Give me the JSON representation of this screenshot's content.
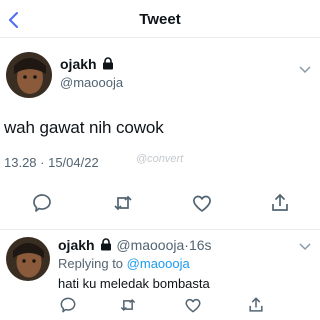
{
  "header": {
    "title": "Tweet"
  },
  "main_tweet": {
    "author_name": "ojakh",
    "author_handle": "@maoooja",
    "text": "wah gawat nih cowok",
    "timestamp": "13.28 · 15/04/22",
    "watermark": "@convert"
  },
  "reply": {
    "author_name": "ojakh",
    "author_handle": "@maoooja",
    "separator": "·",
    "time": "16s",
    "replying_prefix": "Replying to",
    "replying_to": "@maoooja",
    "text": "hati ku meledak bombasta"
  },
  "colors": {
    "accent": "#1d9bf0",
    "muted": "#536471",
    "divider": "#e6ecf0"
  },
  "icons": [
    "back-chevron-icon",
    "lock-icon",
    "chevron-down-icon",
    "reply-icon",
    "retweet-icon",
    "like-icon",
    "share-icon"
  ]
}
